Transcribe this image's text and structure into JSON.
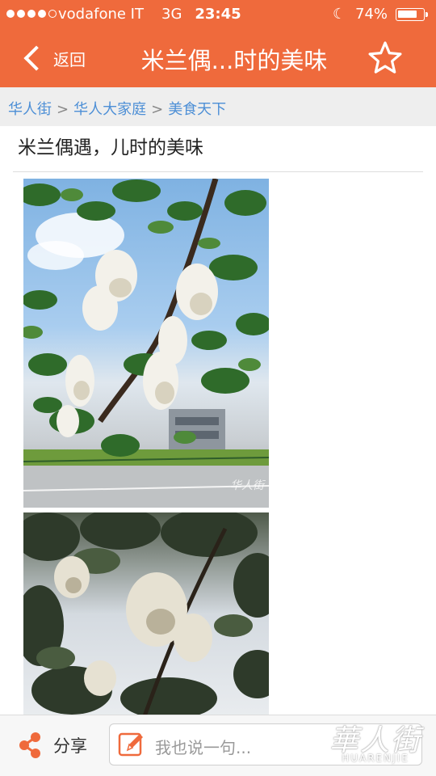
{
  "status_bar": {
    "carrier": "vodafone IT",
    "network": "3G",
    "time": "23:45",
    "battery_percent": "74%",
    "battery_level": 0.74,
    "signal_bars_filled": 4,
    "signal_bars_total": 5
  },
  "nav": {
    "back_label": "返回",
    "title": "米兰偶...时的美味",
    "back_icon": "chevron-left-icon",
    "favorite_icon": "star-icon"
  },
  "breadcrumb": {
    "items": [
      "华人街",
      "华人大家庭",
      "美食天下"
    ],
    "separator": ">"
  },
  "post": {
    "title": "米兰偶遇，儿时的美味",
    "photo_watermark": "华人街"
  },
  "toolbar": {
    "share_label": "分享",
    "comment_placeholder": "我也说一句...",
    "share_icon": "share-icon",
    "edit_icon": "edit-icon"
  },
  "brand": {
    "logo_cn": "華人街",
    "logo_en": "HUARENJIE"
  },
  "colors": {
    "accent": "#ef6a3c",
    "breadcrumb_link": "#4d8fd6",
    "breadcrumb_bg": "#eeeeee"
  }
}
